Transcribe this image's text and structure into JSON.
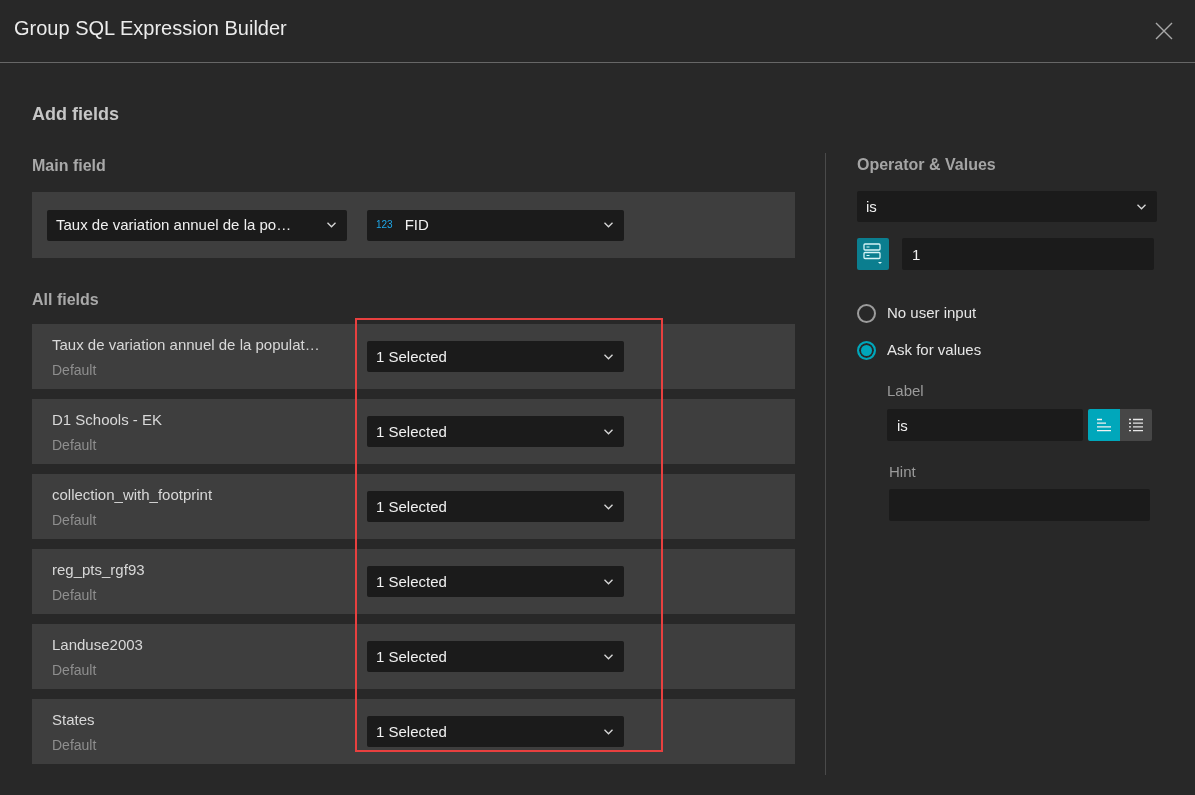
{
  "dialog": {
    "title": "Group SQL Expression Builder"
  },
  "add_fields": {
    "title": "Add fields",
    "main_field": {
      "label": "Main field",
      "layer_select": {
        "value": "Taux de variation annuel de la po…"
      },
      "field_select": {
        "type_badge": "123",
        "value": "FID"
      }
    },
    "all_fields": {
      "label": "All fields",
      "highlighted": true,
      "rows": [
        {
          "name": "Taux de variation annuel de la populat…",
          "subtitle": "Default",
          "select_value": "1 Selected"
        },
        {
          "name": "D1 Schools - EK",
          "subtitle": "Default",
          "select_value": "1 Selected"
        },
        {
          "name": "collection_with_footprint",
          "subtitle": "Default",
          "select_value": "1 Selected"
        },
        {
          "name": "reg_pts_rgf93",
          "subtitle": "Default",
          "select_value": "1 Selected"
        },
        {
          "name": "Landuse2003",
          "subtitle": "Default",
          "select_value": "1 Selected"
        },
        {
          "name": "States",
          "subtitle": "Default",
          "select_value": "1 Selected"
        }
      ]
    }
  },
  "operator_values": {
    "title": "Operator & Values",
    "operator_select": {
      "value": "is"
    },
    "value_input": {
      "value": "1"
    },
    "input_options": [
      {
        "label": "No user input",
        "selected": false
      },
      {
        "label": "Ask for values",
        "selected": true
      }
    ],
    "label_field": {
      "label": "Label",
      "value": "is"
    },
    "label_layout": [
      {
        "kind": "single",
        "selected": true
      },
      {
        "kind": "list",
        "selected": false
      }
    ],
    "hint_field": {
      "label": "Hint"
    }
  }
}
